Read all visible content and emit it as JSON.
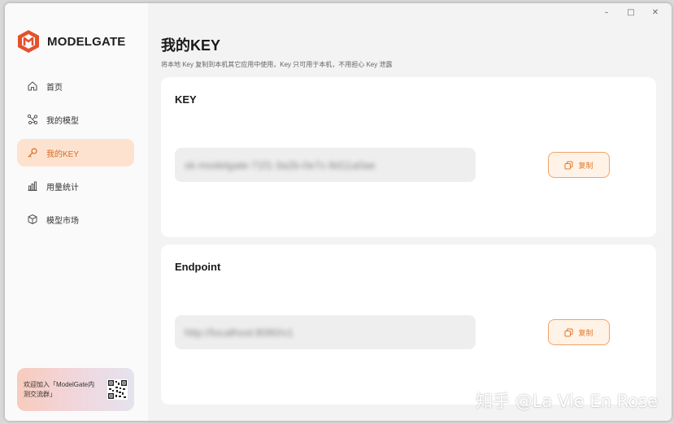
{
  "window": {
    "minimize": "–",
    "maximize": "□",
    "close": "✕"
  },
  "brand": {
    "name": "MODELGATE",
    "accent": "#e5512b"
  },
  "nav": [
    {
      "label": "首页",
      "icon": "home-icon"
    },
    {
      "label": "我的模型",
      "icon": "network-icon"
    },
    {
      "label": "我的KEY",
      "icon": "key-icon",
      "active": true
    },
    {
      "label": "用量统计",
      "icon": "bar-chart-icon"
    },
    {
      "label": "模型市场",
      "icon": "cube-icon"
    }
  ],
  "promo": {
    "text": "欢迎加入「ModelGate内测交流群」",
    "icon": "qr-code-icon"
  },
  "page": {
    "title": "我的KEY",
    "subtitle": "将本地 Key 复制到本机其它应用中使用，Key 只可用于本机，不用担心 Key 泄露"
  },
  "key_card": {
    "title": "KEY",
    "value": "sk-modelgate-71f1-3a2b-0e7c-8d11a0ae",
    "copy_label": "复制"
  },
  "endpoint_card": {
    "title": "Endpoint",
    "value": "http://localhost:8080/v1",
    "copy_label": "复制"
  },
  "watermark": "知乎 @La Vie En Rose",
  "colors": {
    "accent": "#e07a2e",
    "active_bg": "#fde3cf",
    "copy_border": "#f0a36b"
  }
}
